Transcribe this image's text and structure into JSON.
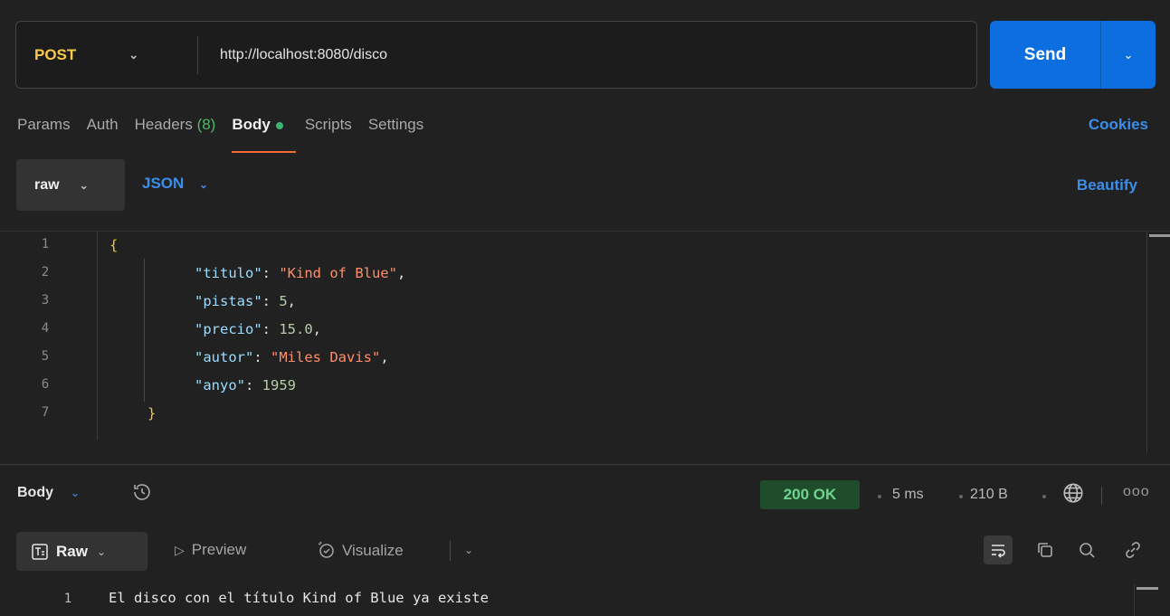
{
  "request": {
    "method": "POST",
    "url": "http://localhost:8080/disco",
    "send_label": "Send"
  },
  "tabs": [
    {
      "label": "Params"
    },
    {
      "label": "Auth"
    },
    {
      "label": "Headers",
      "count": "(8)"
    },
    {
      "label": "Body"
    },
    {
      "label": "Scripts"
    },
    {
      "label": "Settings"
    }
  ],
  "cookies_label": "Cookies",
  "body_options": {
    "mode": "raw",
    "language": "JSON",
    "beautify_label": "Beautify"
  },
  "editor": {
    "lines": [
      {
        "n": "1",
        "text": "{"
      },
      {
        "n": "2",
        "key": "\"titulo\"",
        "value": "\"Kind of Blue\"",
        "value_type": "string",
        "trail": ","
      },
      {
        "n": "3",
        "key": "\"pistas\"",
        "value": "5",
        "value_type": "number",
        "trail": ","
      },
      {
        "n": "4",
        "key": "\"precio\"",
        "value": "15.0",
        "value_type": "number",
        "trail": ","
      },
      {
        "n": "5",
        "key": "\"autor\"",
        "value": "\"Miles Davis\"",
        "value_type": "string",
        "trail": ","
      },
      {
        "n": "6",
        "key": "\"anyo\"",
        "value": "1959",
        "value_type": "number",
        "trail": ""
      },
      {
        "n": "7",
        "text": "}"
      }
    ]
  },
  "response": {
    "section_label": "Body",
    "status": "200 OK",
    "time": "5 ms",
    "size": "210 B",
    "more": "ooo",
    "view_modes": {
      "raw": "Raw",
      "preview": "Preview",
      "visualize": "Visualize"
    },
    "line_number": "1",
    "text": "El disco con el título Kind of Blue ya existe"
  },
  "colors": {
    "send": "#0d6fdf",
    "method": "#f8c94a",
    "accent_link": "#3b8eea",
    "status_ok": "#6fd28d",
    "json_key": "#9cdcfe",
    "json_string": "#ff8f6b",
    "json_number": "#b5cea8"
  },
  "icons": [
    "history-icon",
    "globe-icon",
    "wrap-lines-icon",
    "copy-icon",
    "search-icon",
    "link-icon"
  ]
}
